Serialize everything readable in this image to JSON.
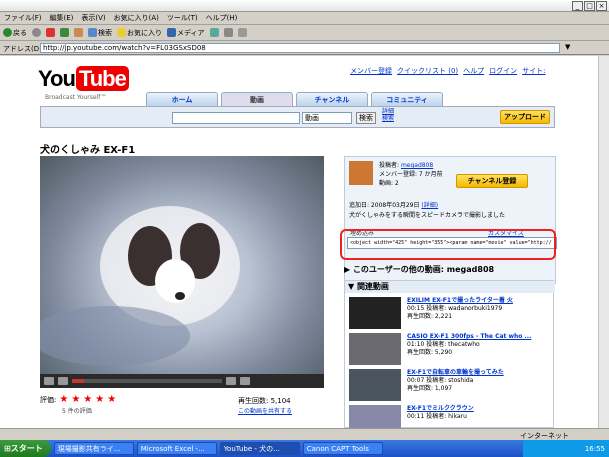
{
  "menu": [
    "ファイル(F)",
    "編集(E)",
    "表示(V)",
    "お気に入り(A)",
    "ツール(T)",
    "ヘルプ(H)"
  ],
  "toolbar": {
    "back": "戻る",
    "search": "検索",
    "favorites": "お気に入り",
    "media": "メディア"
  },
  "address": {
    "label": "アドレス(D)",
    "url": "http://jp.youtube.com/watch?v=FL03GSxSD08"
  },
  "yt": {
    "logo_you": "You",
    "logo_tube": "Tube",
    "broadcast": "Broadcast Yourself™",
    "top_links": [
      "メンバー登録",
      "クイックリスト (0)",
      "ヘルプ",
      "ログイン",
      "サイト:"
    ],
    "tabs": [
      "ホーム",
      "動画",
      "チャンネル",
      "コミュニティ"
    ],
    "search_select": "動画",
    "search_btn": "検索",
    "advanced": "詳細\n検索",
    "upload": "アップロード",
    "video_title": "犬のくしゃみ EX-F1",
    "rating_label": "評価:",
    "ratings_count": "5 件の評価",
    "views": "再生回数: 5,104",
    "share": "この動画を共有する"
  },
  "info": {
    "user_label": "投稿者:",
    "user": "megad808",
    "member_line": "メンバー登録: 7 か月前",
    "videos_line": "動画: 2",
    "subscribe": "チャンネル登録",
    "added": "追加日: 2008年03月29日",
    "more": "(詳細)",
    "desc": "犬がくしゃみをする瞬間をスピードカメラで撮影しました",
    "embed_label": "埋め込み",
    "embed_custom": "カスタマイズ",
    "embed_code": "<object width=\"425\" height=\"355\"><param name=\"movie\" value=\"http://"
  },
  "other_videos": "このユーザーの他の動画: megad808",
  "related": {
    "title": "関連動画",
    "items": [
      {
        "t": "EXILIM EX-F1で撮ったライター着 火",
        "l1": "00:15 投稿者: wadanorbuki1979",
        "l2": "再生回数: 2,221"
      },
      {
        "t": "CASIO EX-F1 300fps - The Cat who ...",
        "l1": "01:10 投稿者: thecatwho",
        "l2": "再生回数: 5,290"
      },
      {
        "t": "EX-F1で自転車の車輪を撮ってみた",
        "l1": "00:07 投稿者: stoshida",
        "l2": "再生回数: 1,097"
      },
      {
        "t": "EX-F1でミルククラウン",
        "l1": "00:11 投稿者: hikaru",
        "l2": ""
      }
    ]
  },
  "taskbar": {
    "start": "スタート",
    "tasks": [
      "現場撮影共有ライ...",
      "Microsoft Excel -...",
      "YouTube - 犬の...",
      "Canon CAPT Tools"
    ],
    "clock": "16:55"
  },
  "status": "インターネット",
  "progress": 0.08
}
